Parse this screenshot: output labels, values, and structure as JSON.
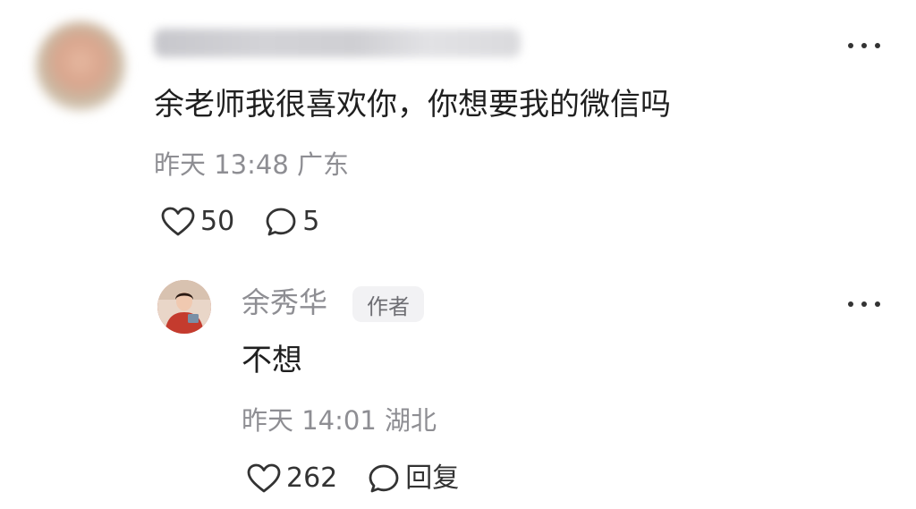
{
  "comment": {
    "text": "余老师我很喜欢你，你想要我的微信吗",
    "time": "昨天 13:48",
    "location": "广东",
    "likes": "50",
    "replies": "5",
    "more_icon": "more-dots-icon"
  },
  "reply": {
    "author": "余秀华",
    "badge": "作者",
    "text": "不想",
    "time": "昨天 14:01",
    "location": "湖北",
    "likes": "262",
    "reply_label": "回复",
    "more_icon": "more-dots-icon"
  },
  "icons": {
    "like": "heart-outline-icon",
    "comment": "speech-bubble-icon"
  },
  "colors": {
    "text": "#1f1f1f",
    "meta": "#8e8e93",
    "badge_bg": "#f2f2f4"
  }
}
